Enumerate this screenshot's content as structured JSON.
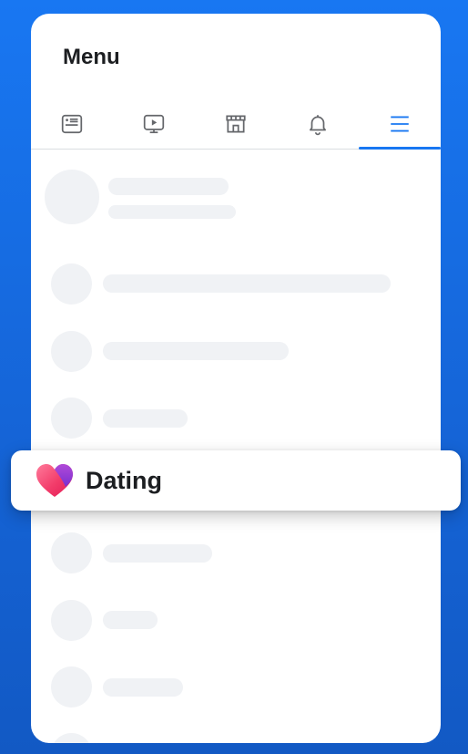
{
  "menu": {
    "title": "Menu"
  },
  "tabs": [
    {
      "icon": "news-feed-icon",
      "active": false
    },
    {
      "icon": "watch-icon",
      "active": false
    },
    {
      "icon": "marketplace-icon",
      "active": false
    },
    {
      "icon": "notifications-bell-icon",
      "active": false
    },
    {
      "icon": "hamburger-menu-icon",
      "active": true
    }
  ],
  "dating_shortcut": {
    "label": "Dating",
    "icon": "dating-heart-icon"
  },
  "colors": {
    "accent": "#1877f2",
    "background": "#1565d8",
    "skeleton": "#f0f2f5",
    "text": "#1c1e21",
    "icon_gray": "#65676b"
  }
}
